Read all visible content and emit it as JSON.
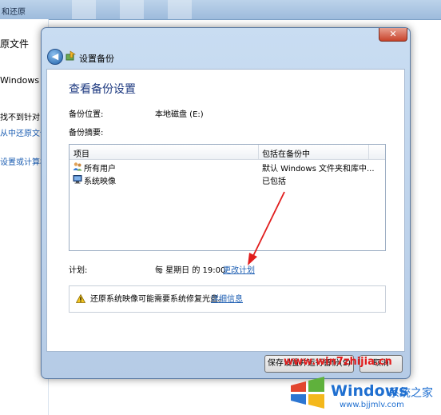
{
  "background_window": {
    "title": "和还原",
    "left_texts": [
      "原文件",
      "Windows 备",
      "找不到针对",
      "从中还原文件",
      "设置或计算机"
    ]
  },
  "dialog": {
    "title": "设置备份",
    "close_glyph": "✕",
    "heading": "查看备份设置",
    "location_label": "备份位置:",
    "location_value": "本地磁盘 (E:)",
    "summary_label": "备份摘要:",
    "columns": [
      "项目",
      "包括在备份中"
    ],
    "rows": [
      {
        "icon": "users-icon",
        "item": "所有用户",
        "included": "默认 Windows 文件夹和库中..."
      },
      {
        "icon": "system-image-icon",
        "item": "系统映像",
        "included": "已包括"
      }
    ],
    "schedule_label": "计划:",
    "schedule_value": "每 星期日 的 19:00",
    "change_schedule_link": "更改计划",
    "warning_text": "还原系统映像可能需要系统修复光盘。",
    "more_info_link": "详细信息",
    "save_button": "保存设置并运行备份(S)",
    "cancel_button": "取消"
  },
  "watermark": {
    "url": "www.win7zhijia.cn",
    "brand": "Windows",
    "brand_suffix": "系统之家",
    "site": "www.bjjmlv.com"
  },
  "colors": {
    "accent_link": "#1e5fb3",
    "heading": "#1e3a80",
    "arrow": "#e11d1d"
  }
}
